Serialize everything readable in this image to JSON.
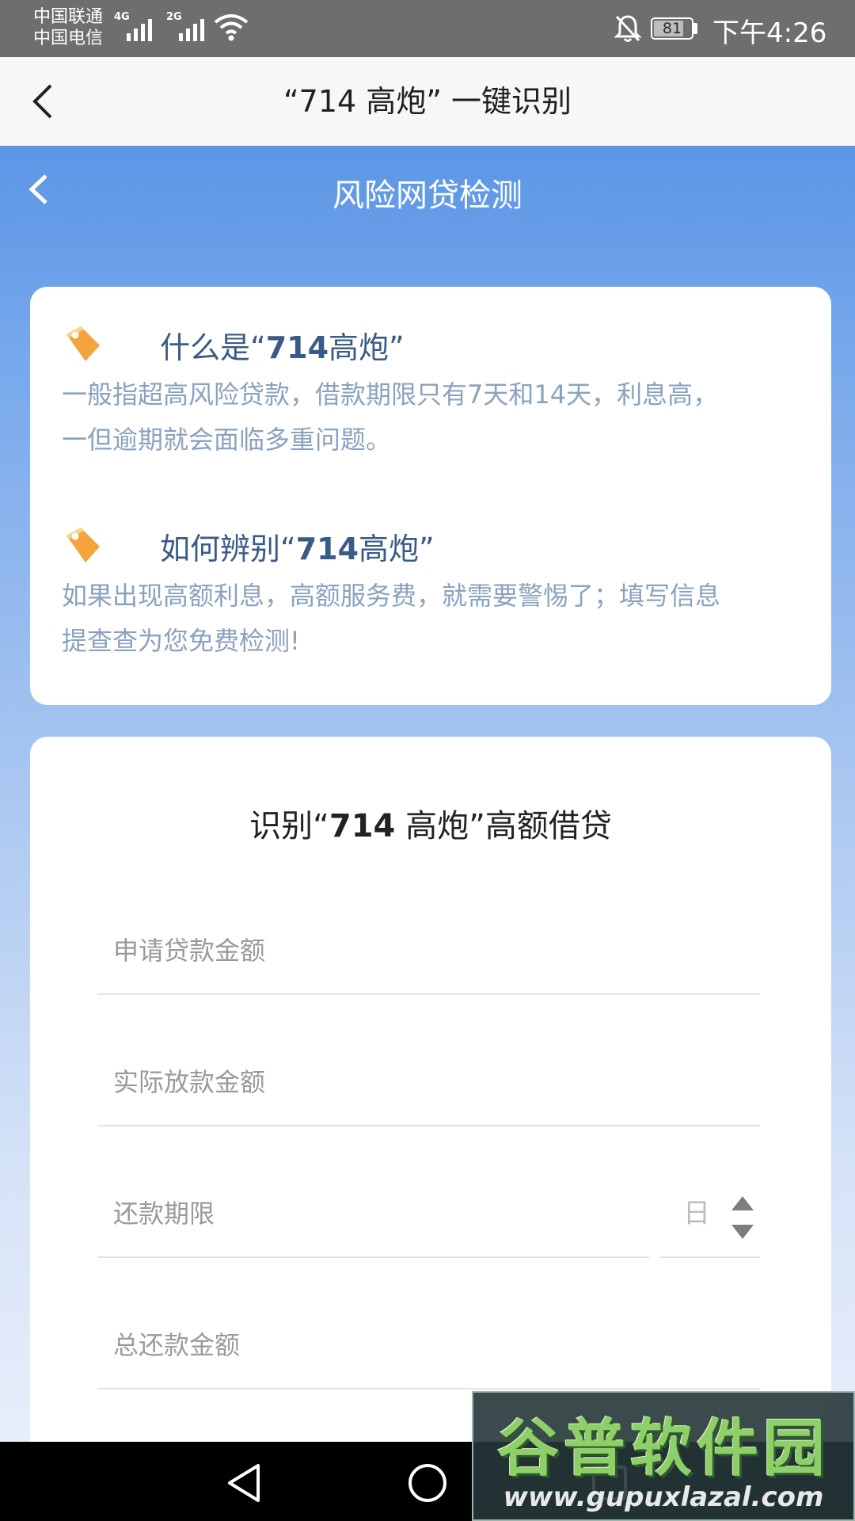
{
  "status_bar": {
    "carrier_1": "中国联通",
    "carrier_2": "中国电信",
    "network_1": "4G",
    "network_2": "2G",
    "battery_level": "81",
    "battery_fraction": 0.81,
    "time": "下午4:26",
    "icons": [
      "signal-icon",
      "wifi-icon",
      "bell-off-icon",
      "battery-icon"
    ]
  },
  "app_bar": {
    "title": "“714 高炮” 一键识别",
    "back_icon": "chevron-left-icon"
  },
  "page": {
    "title": "风险网贷检测",
    "back_icon": "chevron-left-icon"
  },
  "info": {
    "items": [
      {
        "heading_prefix": "什么是“",
        "heading_bold": "714",
        "heading_suffix": "高炮”",
        "line_1": "一般指超高风险贷款，借款期限只有7天和14天，利息高，",
        "line_2": "一但逾期就会面临多重问题。",
        "icon": "tag-icon"
      },
      {
        "heading_prefix": "如何辨别“",
        "heading_bold": "714",
        "heading_suffix": "高炮”",
        "line_1": "如果出现高额利息，高额服务费，就需要警惕了；填写信息",
        "line_2": "提查查为您免费检测!",
        "icon": "tag-icon"
      }
    ]
  },
  "form": {
    "title_prefix": "识别“",
    "title_bold": "714",
    "title_suffix": " 高炮”高额借贷",
    "fields": [
      {
        "placeholder": "申请贷款金额",
        "value": ""
      },
      {
        "placeholder": "实际放款金额",
        "value": ""
      },
      {
        "placeholder": "还款期限",
        "value": ""
      },
      {
        "placeholder": "总还款金额",
        "value": ""
      }
    ],
    "term_unit": "日"
  },
  "nav_bar": {
    "icons": [
      "back-triangle-icon",
      "home-circle-icon",
      "recents-square-icon"
    ]
  },
  "watermark": {
    "brand": "谷普软件园",
    "url": "www.gupuxlazal.com"
  },
  "colors": {
    "primary_blue": "#5c96e5",
    "heading_blue": "#3a5a87",
    "body_text": "#8aa1c0",
    "tag_orange": "#f5a33c"
  }
}
